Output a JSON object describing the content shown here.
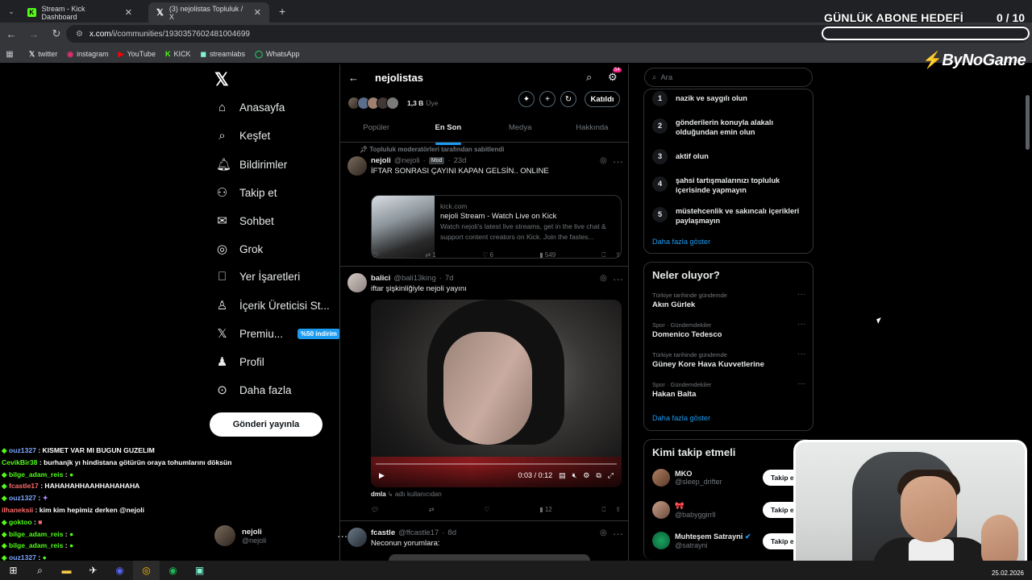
{
  "browser": {
    "tabs": [
      {
        "title": "Stream - Kick Dashboard"
      },
      {
        "title": "(3) nejolistas Topluluk / X"
      }
    ],
    "url_host": "x.com",
    "url_path": "/i/communities/1930357602481004699",
    "bookmarks": [
      "twitter",
      "instagram",
      "YouTube",
      "KICK",
      "streamlabs",
      "WhatsApp"
    ]
  },
  "overlay": {
    "sub_goal_label": "GÜNLÜK ABONE HEDEFİ",
    "sub_goal_count": "0 / 10",
    "brand": "ByNoGame"
  },
  "nav": {
    "items": [
      {
        "label": "Anasayfa",
        "icon": "home-icon"
      },
      {
        "label": "Keşfet",
        "icon": "search-icon"
      },
      {
        "label": "Bildirimler",
        "icon": "bell-icon"
      },
      {
        "label": "Takip et",
        "icon": "follow-icon"
      },
      {
        "label": "Sohbet",
        "icon": "mail-icon"
      },
      {
        "label": "Grok",
        "icon": "grok-icon"
      },
      {
        "label": "Yer İşaretleri",
        "icon": "bookmark-icon"
      },
      {
        "label": "İçerik Üreticisi St...",
        "icon": "creator-icon"
      },
      {
        "label": "Premiu...",
        "icon": "x-icon"
      },
      {
        "label": "Profil",
        "icon": "profile-icon"
      },
      {
        "label": "Daha fazla",
        "icon": "more-icon"
      }
    ],
    "premium_badge": "%50 indirim",
    "post_button": "Gönderi yayınla",
    "profile_name": "nejoli",
    "profile_handle": "@nejoli"
  },
  "chat": [
    {
      "user": "ouz1327",
      "msg": ": KISMET VAR MI BUGUN GUZELIM"
    },
    {
      "user": "CevikBir38",
      "msg": ": burhanjk yı hindistana götürün oraya tohumlarını döksün"
    },
    {
      "user": "bilge_adam_reis",
      "msg": ":"
    },
    {
      "user": "fcastle17",
      "msg": ": HAHAHAHHAAHHAHAHAHA"
    },
    {
      "user": "ouz1327",
      "msg": ":"
    },
    {
      "user": "ilhaneksii",
      "msg": ": kim kim hepimiz derken @nejoli"
    },
    {
      "user": "goktoo",
      "msg": ":"
    },
    {
      "user": "bilge_adam_reis",
      "msg": ":"
    },
    {
      "user": "bilge_adam_reis",
      "msg": ":"
    },
    {
      "user": "ouz1327",
      "msg": ":"
    }
  ],
  "community": {
    "name": "nejolistas",
    "member_count": "1,3 B",
    "member_label": "Üye",
    "notif_count": "54",
    "join_label": "Katıldı",
    "tabs": [
      "Popüler",
      "En Son",
      "Medya",
      "Hakkında"
    ],
    "pinned_label": "Topluluk moderatörleri tarafından sabitlendi"
  },
  "posts": [
    {
      "name": "nejoli",
      "handle": "@nejoli",
      "badge": "Mod",
      "time": "23d",
      "text": "İFTAR SONRASI ÇAYINI KAPAN GELSİN.. ONLINE",
      "card_domain": "kick.com",
      "card_title": "nejoli Stream - Watch Live on Kick",
      "card_desc": "Watch nejoli's latest live streams, get in the live chat & support content creators on Kick. Join the fastes...",
      "replies": "",
      "reposts": "1",
      "likes": "6",
      "views": "549"
    },
    {
      "name": "balici",
      "handle": "@bali13king",
      "time": "7d",
      "text": "iftar şişkinliğiyle nejoli yayını",
      "video_time": "0:03 / 0:12",
      "caption_user": "dmla",
      "caption_text": "adlı kullanıcıdan",
      "views": "12"
    },
    {
      "name": "fcastle",
      "handle": "@ffcastle17",
      "time": "8d",
      "text": "Neconun yorumlara:"
    }
  ],
  "right": {
    "search_placeholder": "Ara",
    "rules": [
      {
        "n": "1",
        "text": "nazik ve saygılı olun"
      },
      {
        "n": "2",
        "text": "gönderilerin konuyla alakalı olduğundan emin olun"
      },
      {
        "n": "3",
        "text": "aktif olun"
      },
      {
        "n": "4",
        "text": "şahsi tartışmalarınızı topluluk içerisinde yapmayın"
      },
      {
        "n": "5",
        "text": "müstehcenlik ve sakıncalı içerikleri paylaşmayın"
      }
    ],
    "show_more": "Daha fazla göster",
    "trends_title": "Neler oluyor?",
    "trends": [
      {
        "context": "Türkiye tarihinde gündemde",
        "topic": "Akın Gürlek"
      },
      {
        "context": "Spor · Gündemdekiler",
        "topic": "Domenico Tedesco"
      },
      {
        "context": "Türkiye tarihinde gündemde",
        "topic": "Güney Kore Hava Kuvvetlerine"
      },
      {
        "context": "Spor · Gündemdekiler",
        "topic": "Hakan Balta"
      }
    ],
    "who_title": "Kimi takip etmeli",
    "who": [
      {
        "name": "MKO",
        "handle": "@sleep_drifter"
      },
      {
        "name": "🎀",
        "handle": "@babyggirrll"
      },
      {
        "name": "Muhteşem Satraynі",
        "handle": "@satraynі"
      }
    ],
    "follow_label": "Takip e"
  },
  "taskbar": {
    "date": "25.02.2026"
  }
}
